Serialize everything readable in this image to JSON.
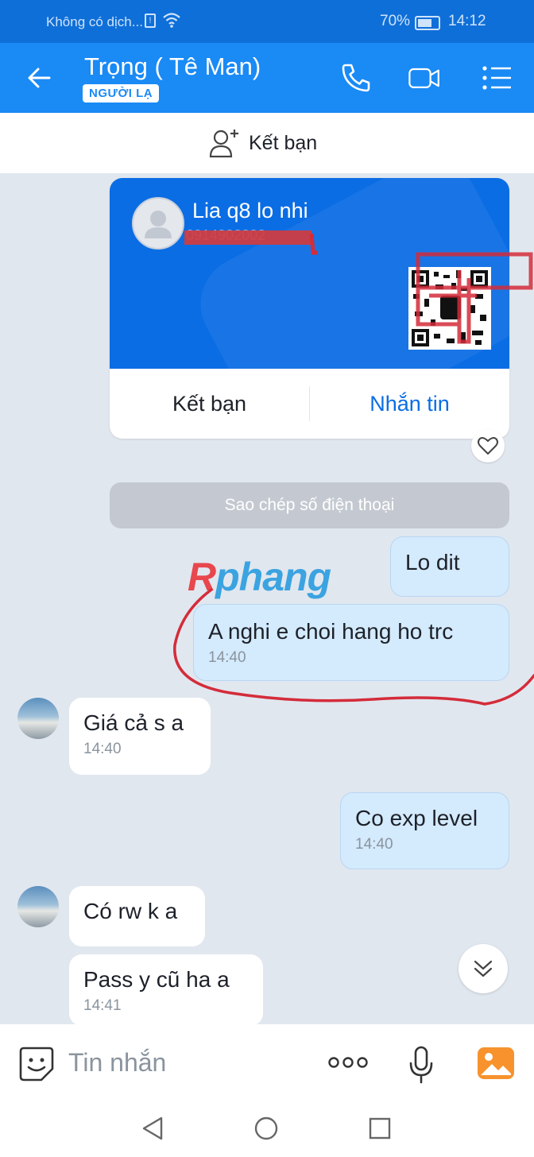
{
  "status_bar": {
    "carrier": "Không có dịch...",
    "battery": "70%",
    "time": "14:12"
  },
  "header": {
    "title": "Trọng ( Tê Man)",
    "badge": "NGƯỜI LẠ",
    "icons": [
      "back-arrow-icon",
      "phone-icon",
      "video-call-icon",
      "menu-list-icon"
    ]
  },
  "add_friend_bar": {
    "label": "Kết bạn"
  },
  "contact_card": {
    "name": "Lia q8 lo nhi",
    "phone": "0914902002",
    "add_friend_label": "Kết bạn",
    "message_label": "Nhắn tin"
  },
  "system_message": "Sao chép số điện thoại",
  "watermark": {
    "prefix": "R",
    "text": "phang"
  },
  "messages": [
    {
      "from": "me",
      "text": "Lo dit",
      "time": ""
    },
    {
      "from": "me",
      "text": "A nghi e choi hang ho trc",
      "time": "14:40"
    },
    {
      "from": "them",
      "text": "Giá cả s a",
      "time": "14:40"
    },
    {
      "from": "me",
      "text": "Co exp level",
      "time": "14:40"
    },
    {
      "from": "them",
      "text": "Có rw k a",
      "time": ""
    },
    {
      "from": "them",
      "text": "Pass y cũ ha a",
      "time": "14:41"
    }
  ],
  "input": {
    "placeholder": "Tin nhắn"
  },
  "colors": {
    "header_blue": "#1a8af5",
    "status_blue": "#0f6fd8",
    "card_blue": "#0b6de4",
    "my_bubble": "#d4eafd",
    "annotation_red": "#d42c3a"
  }
}
